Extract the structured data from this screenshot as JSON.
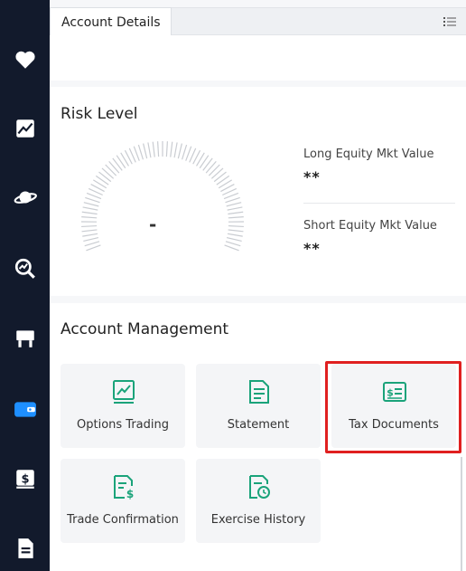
{
  "sidebar": {
    "items": [
      {
        "icon": "heart-icon"
      },
      {
        "icon": "chart-trend-icon"
      },
      {
        "icon": "planet-icon"
      },
      {
        "icon": "search-chart-icon"
      },
      {
        "icon": "bridge-icon"
      },
      {
        "icon": "wallet-icon",
        "active": true
      },
      {
        "icon": "dollar-doc-icon"
      },
      {
        "icon": "document-icon"
      }
    ],
    "active_color": "#1e8fff",
    "icon_color": "#ffffff"
  },
  "tabs": {
    "active_label": "Account Details"
  },
  "risk": {
    "title": "Risk Level",
    "gauge_value": "-",
    "long_label": "Long Equity Mkt Value",
    "long_value": "**",
    "short_label": "Short Equity Mkt Value",
    "short_value": "**"
  },
  "management": {
    "title": "Account Management",
    "tiles": [
      {
        "label": "Options Trading",
        "icon": "options-chart-icon"
      },
      {
        "label": "Statement",
        "icon": "statement-doc-icon"
      },
      {
        "label": "Tax Documents",
        "icon": "tax-bill-icon",
        "highlighted": true
      },
      {
        "label": "Trade Confirmation",
        "icon": "trade-doc-dollar-icon"
      },
      {
        "label": "Exercise History",
        "icon": "history-doc-clock-icon"
      }
    ]
  },
  "colors": {
    "accent_green": "#1aa37a",
    "highlight_red": "#e02020"
  }
}
